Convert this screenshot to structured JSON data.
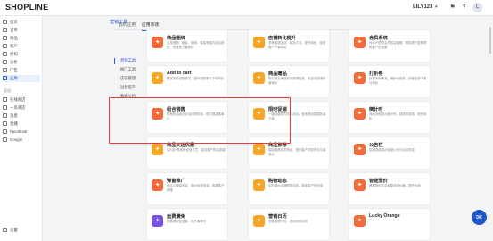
{
  "brand": "SHOPLINE",
  "store_name": "LILY123",
  "avatar_initial": "L",
  "sidebar": {
    "items": [
      {
        "label": "首页",
        "icon": "home-icon"
      },
      {
        "label": "订单",
        "icon": "order-icon"
      },
      {
        "label": "商品",
        "icon": "product-icon"
      },
      {
        "label": "客户",
        "icon": "customer-icon"
      },
      {
        "label": "折扣",
        "icon": "discount-icon"
      },
      {
        "label": "分析",
        "icon": "analytics-icon"
      },
      {
        "label": "广告",
        "icon": "ads-icon"
      },
      {
        "label": "应用",
        "icon": "apps-icon"
      }
    ],
    "section_label": "渠道",
    "channels": [
      {
        "label": "在线商店",
        "icon": "store-icon"
      },
      {
        "label": "一页商店",
        "icon": "onepage-icon"
      },
      {
        "label": "消息",
        "icon": "message-icon"
      },
      {
        "label": "直播",
        "icon": "live-icon"
      },
      {
        "label": "Facebook",
        "icon": "facebook-icon"
      },
      {
        "label": "Google",
        "icon": "google-icon"
      }
    ],
    "settings_label": "设置"
  },
  "tabs": [
    "我的应用",
    "应用市场"
  ],
  "subnav": [
    "营销工具",
    "推广工具",
    "店铺管理",
    "运营提升",
    "数据分析"
  ],
  "section_title": "营销工具",
  "cards": [
    {
      "title": "商品捆绑",
      "desc": "支持搭配、组合、捆绑、套装等模式组合销售，快速提升客单价",
      "color": "#f26b3a",
      "icon": "bundle-icon"
    },
    {
      "title": "店铺转化提升",
      "desc": "多种促销活动，精准引流，提升转化，促进客户下单购买",
      "color": "#f5a623",
      "icon": "conversion-icon"
    },
    {
      "title": "会员系统",
      "desc": "为商户提供会员权益管理，帮助提升复购率和客户忠诚度",
      "color": "#f26b3a",
      "icon": "member-icon"
    },
    {
      "title": "Add to cart",
      "desc": "提供多种加购样式，提升加购率与下单转化",
      "color": "#f5a623",
      "icon": "cart-icon"
    },
    {
      "title": "商品赠品",
      "desc": "购买指定商品即可获得赠品，刺激消费提升客单价",
      "color": "#f5a623",
      "icon": "gift-icon"
    },
    {
      "title": "打折券",
      "desc": "设置多种满减、满折优惠券，快速促进下单与转化",
      "color": "#f26b3a",
      "icon": "coupon-icon"
    },
    {
      "title": "组合销售",
      "desc": "根据商品组合灵活设置优惠，助力提高客单价",
      "color": "#f26b3a",
      "icon": "combo-icon"
    },
    {
      "title": "限时促销",
      "desc": "一键创建限时特价活动，营造紧迫氛围刺激下单",
      "color": "#f5a623",
      "icon": "flash-sale-icon"
    },
    {
      "title": "倒计时",
      "desc": "商品页面显示倒计时，制造紧张感，提升转化",
      "color": "#f26b3a",
      "icon": "countdown-icon"
    },
    {
      "title": "商品买送优惠",
      "desc": "买X送Y等多种优惠方式，激发客户购买欲望",
      "color": "#f5a623",
      "icon": "bogo-icon"
    },
    {
      "title": "商品推荐",
      "desc": "智能推荐相关商品，提升客户浏览时长与客单价",
      "color": "#f5a623",
      "icon": "recommend-icon"
    },
    {
      "title": "公告栏",
      "desc": "店铺顶部展示促销公告与活动信息",
      "color": "#f26b3a",
      "icon": "announcement-icon"
    },
    {
      "title": "弹窗推广",
      "desc": "自定义弹窗内容，展示优惠信息，收集客户邮箱",
      "color": "#f26b3a",
      "icon": "popup-icon"
    },
    {
      "title": "购物动态",
      "desc": "实时展示店铺购物动态，增强客户信任感",
      "color": "#f5a623",
      "icon": "activity-icon"
    },
    {
      "title": "智能涨价",
      "desc": "根据规则灵活调整商品价格，提升利润",
      "color": "#f26b3a",
      "icon": "price-icon"
    },
    {
      "title": "运费满免",
      "desc": "设置满额免运费，提升客单价",
      "color": "#7b4fe0",
      "icon": "shipping-icon"
    },
    {
      "title": "营销日历",
      "desc": "查看营销节点，提前规划活动",
      "color": "#f5a623",
      "icon": "calendar-icon"
    },
    {
      "title": "Lucky Orange",
      "desc": "",
      "color": "#f26b3a",
      "icon": "orange-icon"
    }
  ]
}
